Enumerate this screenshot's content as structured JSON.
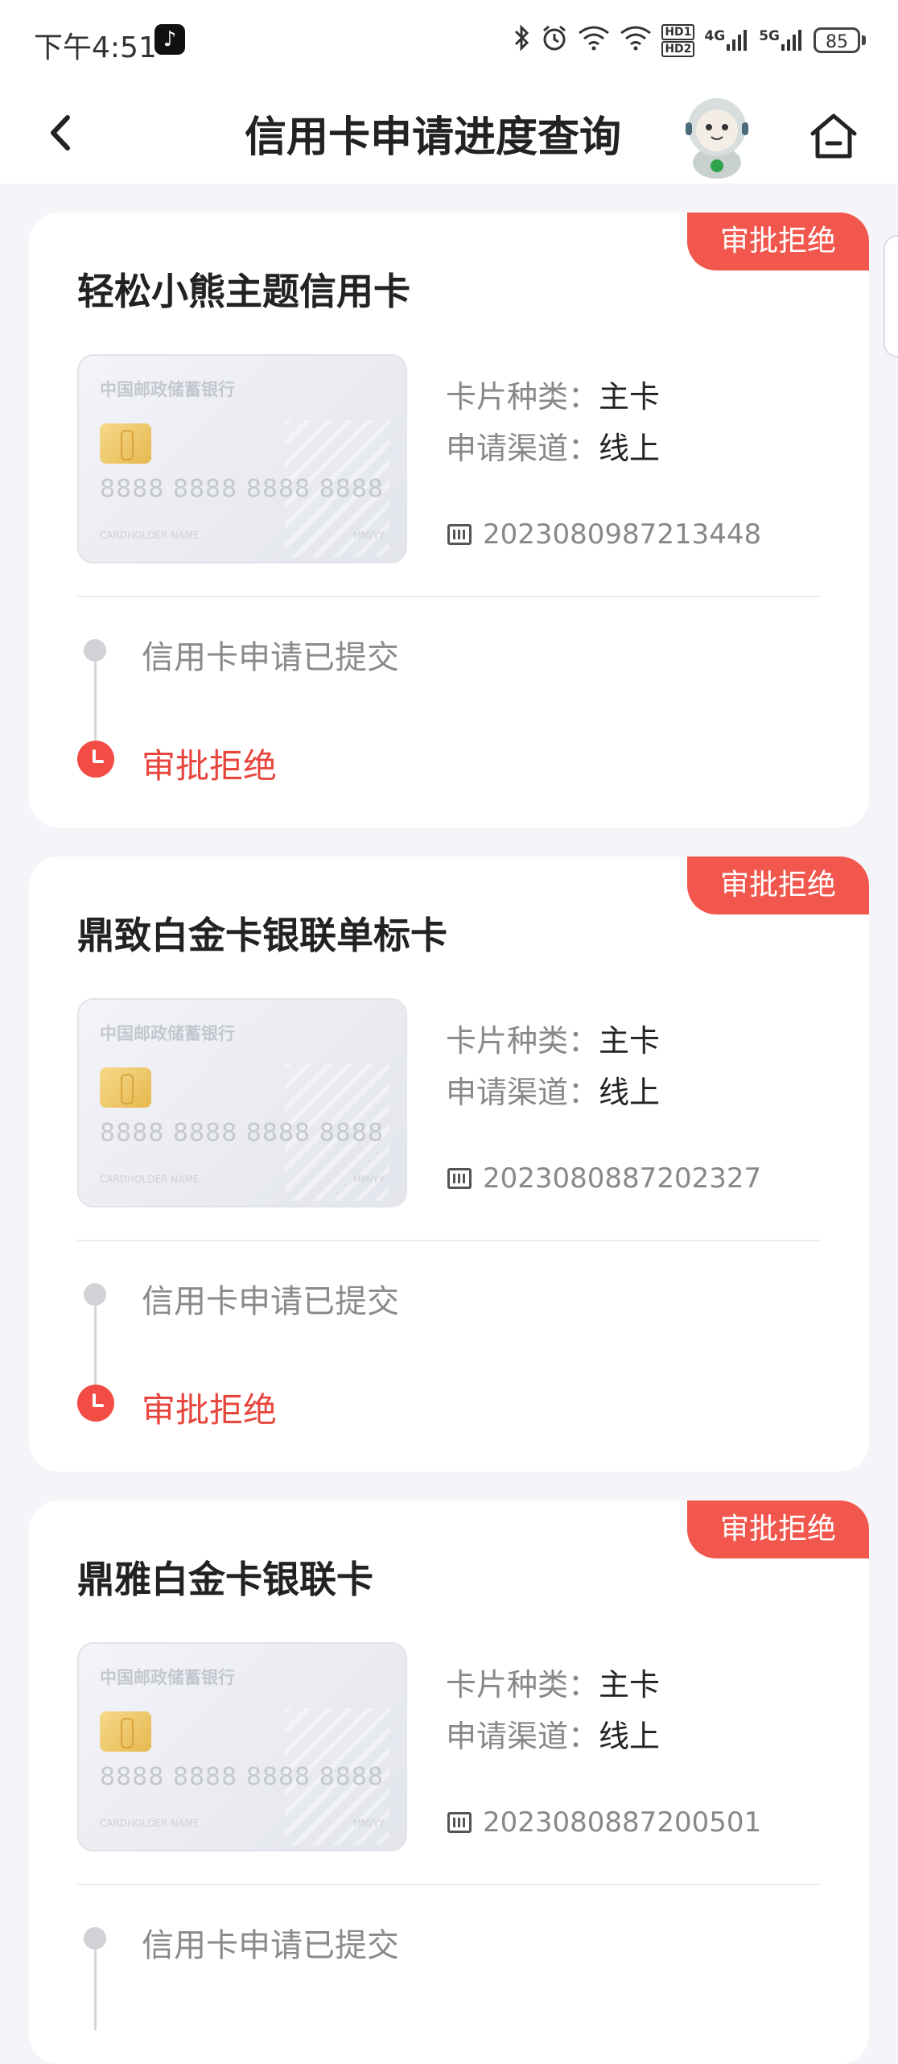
{
  "status_bar": {
    "time": "下午4:51",
    "app_icon": "tiktok-icon",
    "hd1": "HD1",
    "hd2": "HD2",
    "net1": "4G",
    "net2": "5G",
    "battery": "85"
  },
  "nav": {
    "title": "信用卡申请进度查询",
    "back_icon": "chevron-left-icon",
    "home_icon": "home-icon"
  },
  "labels": {
    "card_type": "卡片种类：",
    "channel": "申请渠道："
  },
  "card_image": {
    "bank": "中国邮政储蓄银行",
    "number": "8888 8888 8888 8888",
    "holder": "CARDHOLDER NAME",
    "valid": "MM/YY"
  },
  "cards": [
    {
      "badge": "审批拒绝",
      "name": "轻松小熊主题信用卡",
      "type": "主卡",
      "channel": "线上",
      "app_no": "2023080987213448",
      "step1": "信用卡申请已提交",
      "step2": "审批拒绝"
    },
    {
      "badge": "审批拒绝",
      "name": "鼎致白金卡银联单标卡",
      "type": "主卡",
      "channel": "线上",
      "app_no": "2023080887202327",
      "step1": "信用卡申请已提交",
      "step2": "审批拒绝"
    },
    {
      "badge": "审批拒绝",
      "name": "鼎雅白金卡银联卡",
      "type": "主卡",
      "channel": "线上",
      "app_no": "2023080887200501",
      "step1": "信用卡申请已提交",
      "step2": ""
    }
  ],
  "colors": {
    "accent_red": "#f2574d",
    "background": "#f4f4f9"
  }
}
